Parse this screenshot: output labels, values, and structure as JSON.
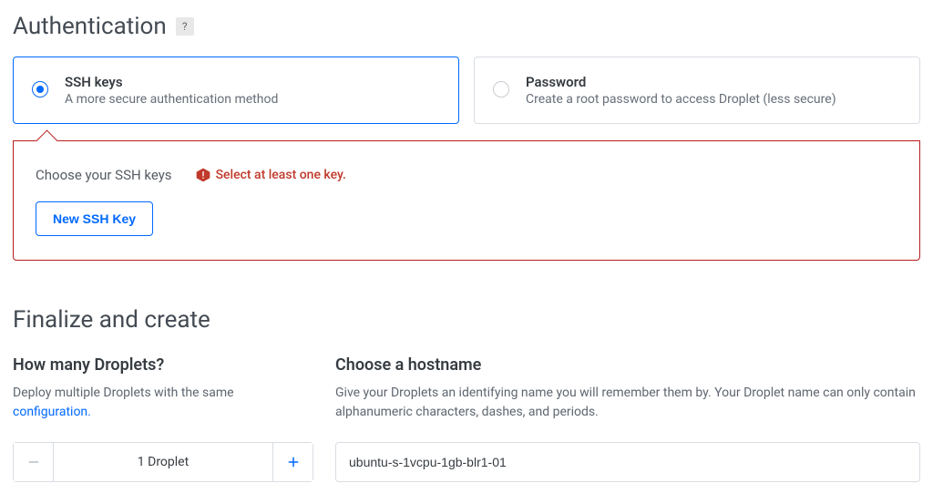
{
  "auth": {
    "title": "Authentication",
    "help": "?",
    "ssh": {
      "title": "SSH keys",
      "desc": "A more secure authentication method"
    },
    "password": {
      "title": "Password",
      "desc": "Create a root password to access Droplet (less secure)"
    }
  },
  "ssh_panel": {
    "choose_label": "Choose your SSH keys",
    "error": "Select at least one key.",
    "new_btn": "New SSH Key"
  },
  "finalize": {
    "title": "Finalize and create",
    "droplets": {
      "title": "How many Droplets?",
      "desc_pre": "Deploy multiple Droplets with the same ",
      "desc_link": "configuration.",
      "count_label": "1  Droplet"
    },
    "hostname": {
      "title": "Choose a hostname",
      "desc": "Give your Droplets an identifying name you will remember them by. Your Droplet name can only contain alphanumeric characters, dashes, and periods.",
      "value": "ubuntu-s-1vcpu-1gb-blr1-01"
    }
  }
}
